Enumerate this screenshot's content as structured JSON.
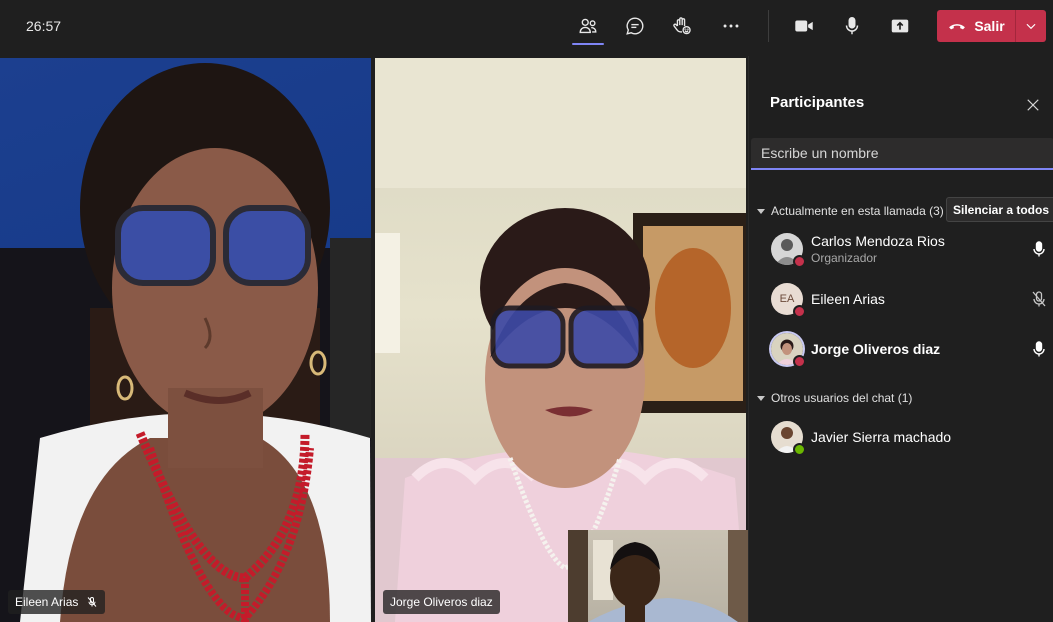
{
  "toolbar": {
    "timer": "26:57",
    "leave_label": "Salir",
    "icons": [
      "participants-icon",
      "chat-icon",
      "raise-hand-icon",
      "more-icon",
      "camera-icon",
      "microphone-icon",
      "share-icon",
      "phone-hangup-icon",
      "chevron-down-icon"
    ]
  },
  "stage": {
    "tiles": [
      {
        "name": "Eileen Arias",
        "muted": true
      },
      {
        "name": "Jorge Oliveros diaz",
        "muted": false
      }
    ]
  },
  "panel": {
    "title": "Participantes",
    "search_placeholder": "Escribe un nombre",
    "in_call_header": "Actualmente en esta llamada (3)",
    "mute_all_label": "Silenciar a todos",
    "participants": [
      {
        "name": "Carlos Mendoza Rios",
        "role": "Organizador",
        "initials": "",
        "status": "busy",
        "mic": "on"
      },
      {
        "name": "Eileen Arias",
        "role": "",
        "initials": "EA",
        "status": "busy",
        "mic": "off"
      },
      {
        "name": "Jorge Oliveros diaz",
        "role": "",
        "initials": "",
        "status": "busy",
        "mic": "on"
      }
    ],
    "other_header": "Otros usuarios del chat (1)",
    "others": [
      {
        "name": "Javier Sierra machado",
        "status": "available"
      }
    ]
  },
  "colors": {
    "accent": "#7f85f5",
    "leave": "#c4314b",
    "busy": "#c4314b",
    "available": "#6bb700",
    "background": "#1f1f1f"
  }
}
